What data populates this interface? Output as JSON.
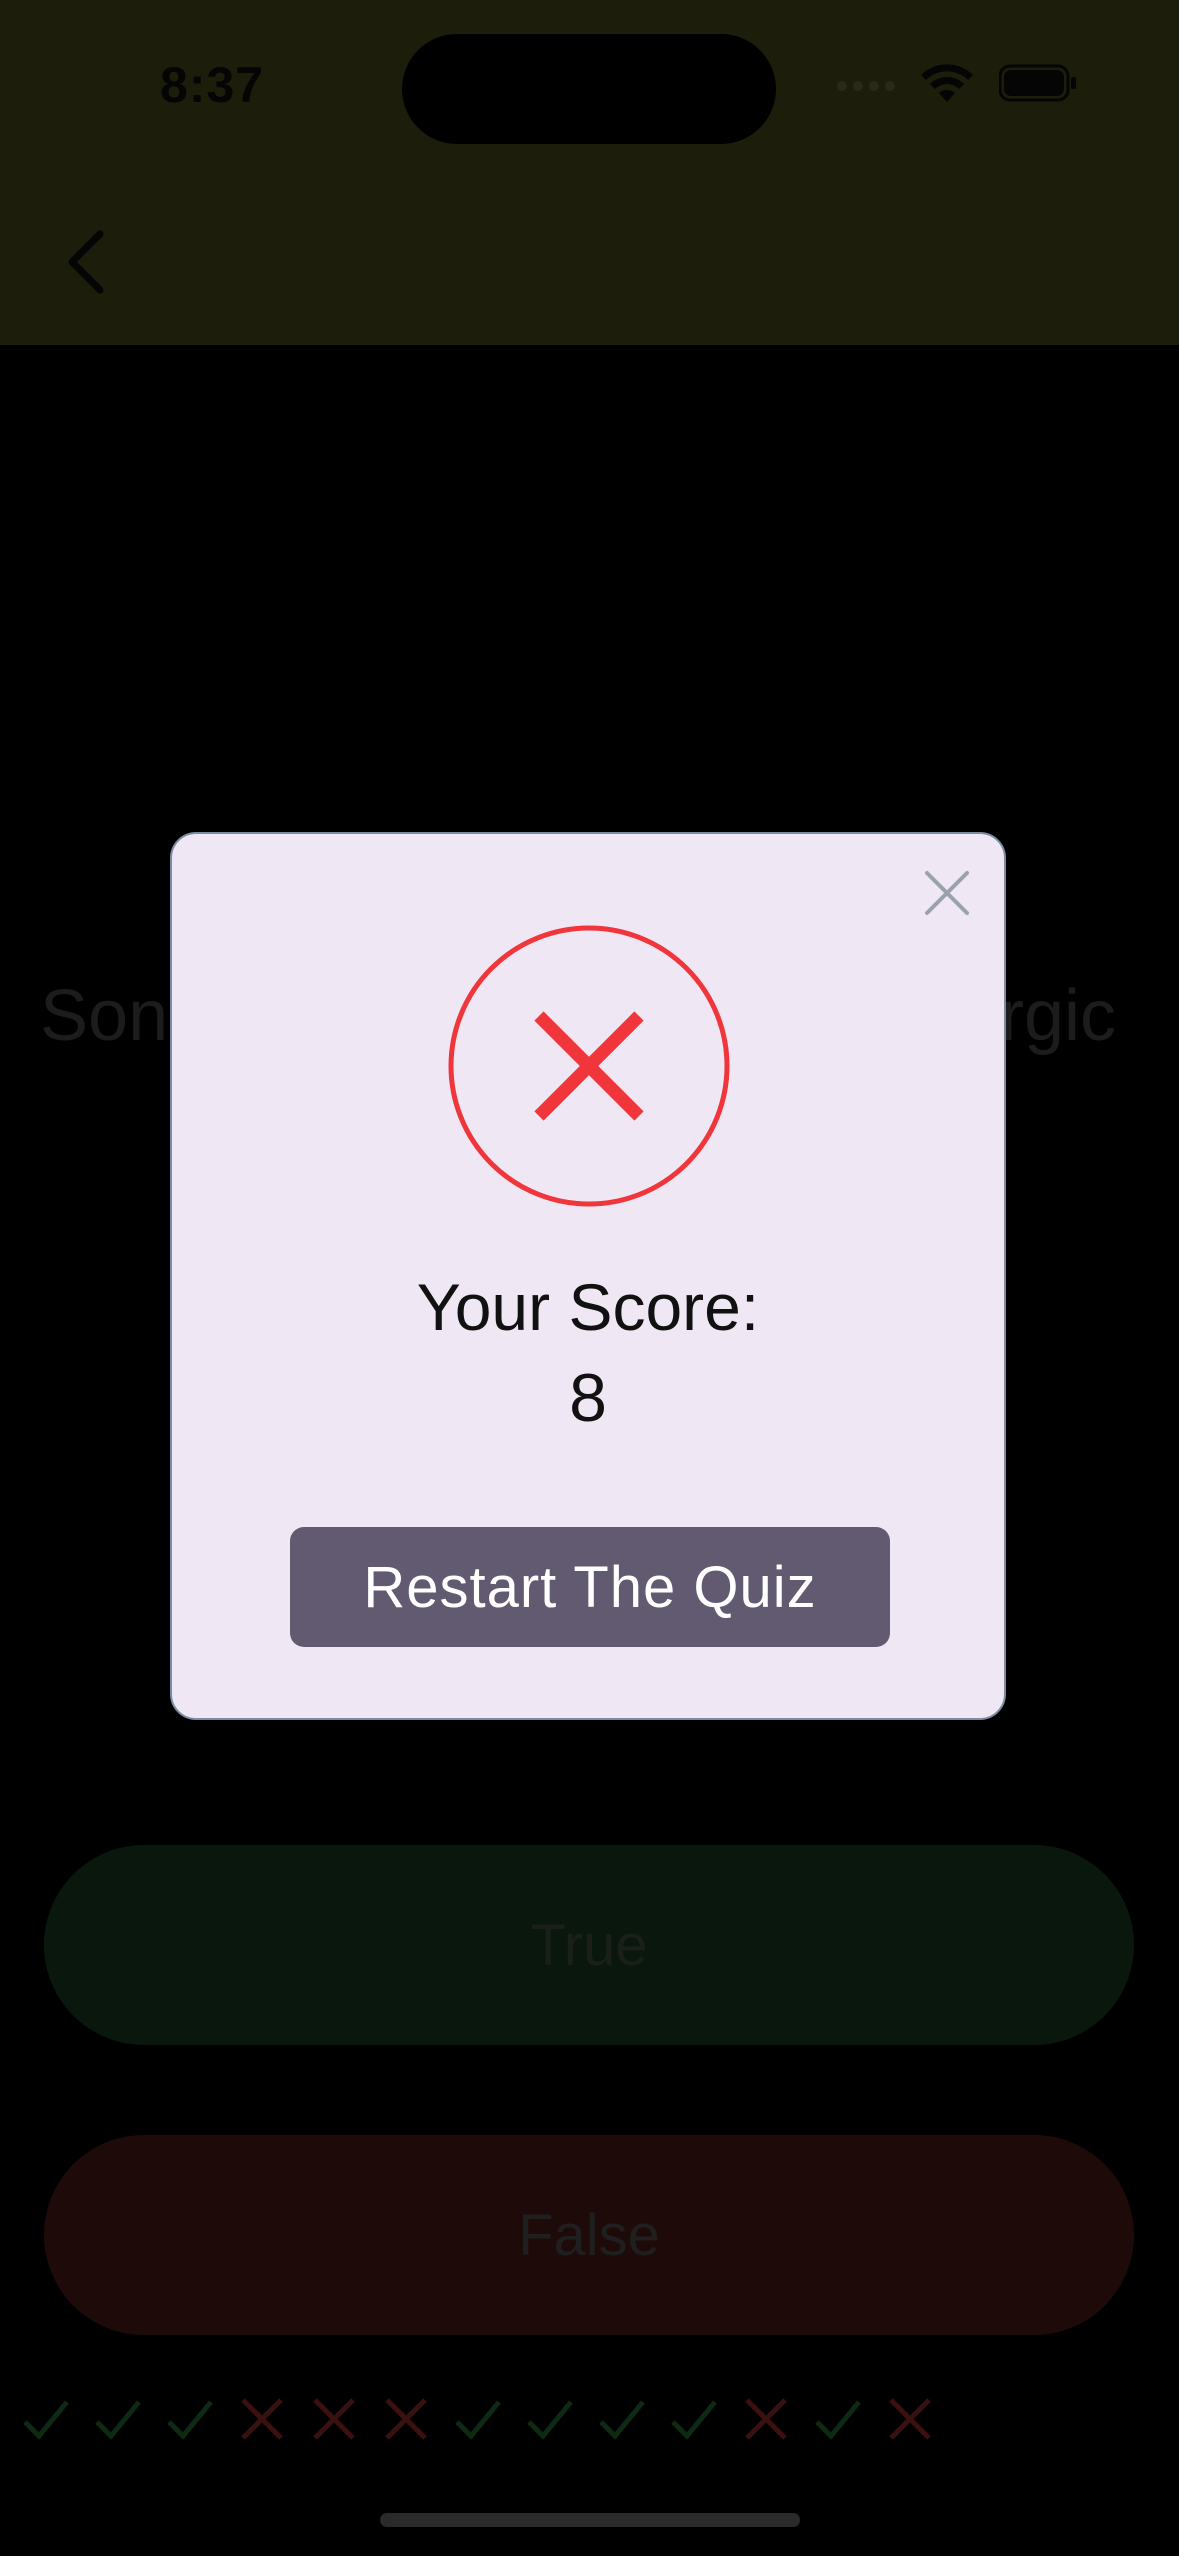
{
  "status_bar": {
    "time": "8:37"
  },
  "background": {
    "question_left": "Son",
    "question_right": "rgic",
    "true_label": "True",
    "false_label": "False",
    "score_marks": [
      "check",
      "check",
      "check",
      "cross",
      "cross",
      "cross",
      "check",
      "check",
      "check",
      "check",
      "cross",
      "check",
      "cross"
    ]
  },
  "dialog": {
    "score_label": "Your Score:",
    "score_value": "8",
    "restart_label": "Restart The Quiz"
  },
  "colors": {
    "appbar": "#1c1d0b",
    "dialog_bg": "#efe7f4",
    "fail_red": "#f0353b",
    "button_bg": "#625a70",
    "check_dim": "#0f2a14",
    "cross_dim": "#3a1010"
  },
  "icons": {
    "back": "chevron-left-icon",
    "close": "close-icon",
    "fail": "x-circle-icon",
    "wifi": "wifi-icon",
    "battery": "battery-icon"
  }
}
